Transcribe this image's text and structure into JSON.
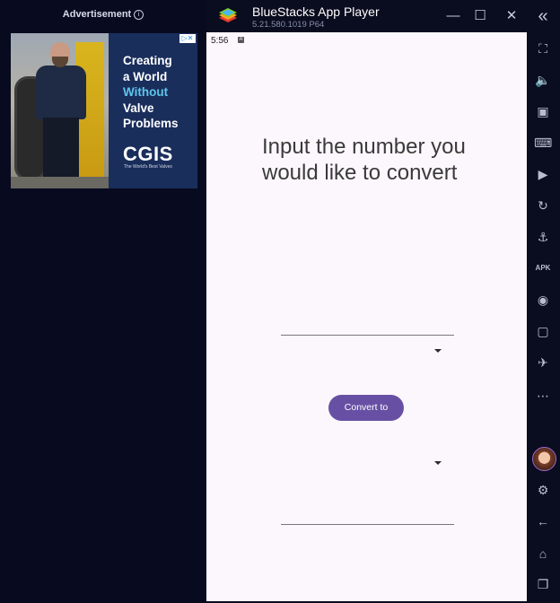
{
  "ad": {
    "header": "Advertisement",
    "info_glyph": "i",
    "adchoices": "▷✕",
    "headline_line1": "Creating",
    "headline_line2": "a World",
    "headline_line3": "Without",
    "headline_line4": "Valve",
    "headline_line5": "Problems",
    "brand": "CGIS",
    "tagline": "The World's Best Valves"
  },
  "window": {
    "title": "BlueStacks App Player",
    "version": "5.21.580.1019  P64",
    "minimize_glyph": "—",
    "maximize_glyph": "☐",
    "close_glyph": "✕",
    "collapse_glyph": "«"
  },
  "status": {
    "time": "5:56",
    "icon_glyph": "A"
  },
  "main": {
    "prompt": "Input the number you would like to convert",
    "convert_button": "Convert to"
  },
  "sidebar": {
    "icons": [
      "⛶",
      "🔈",
      "▣",
      "⌨",
      "▶",
      "↻",
      "⚓",
      "APK",
      "◉",
      "▢",
      "✈",
      "⋯",
      "⚙",
      "←",
      "⌂",
      "❐"
    ]
  },
  "colors": {
    "accent": "#6750a4",
    "screen_bg": "#fcf7fc",
    "chrome_bg": "#0a0c1f"
  }
}
